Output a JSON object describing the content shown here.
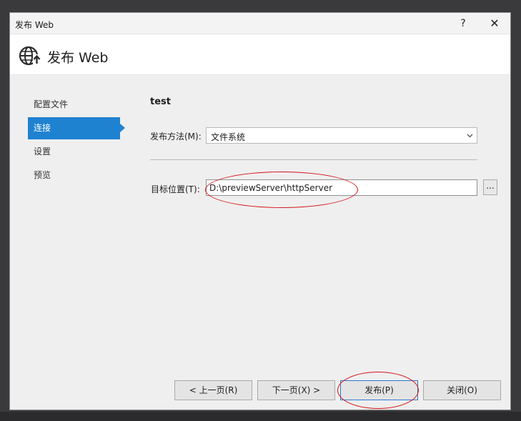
{
  "window": {
    "title": "发布 Web",
    "help_label": "?",
    "close_label": "✕"
  },
  "banner": {
    "title": "发布 Web",
    "icon": "globe-publish-icon"
  },
  "nav": {
    "items": [
      {
        "label": "配置文件",
        "active": false
      },
      {
        "label": "连接",
        "active": true
      },
      {
        "label": "设置",
        "active": false
      },
      {
        "label": "预览",
        "active": false
      }
    ]
  },
  "main": {
    "profile_name": "test",
    "publish_method": {
      "label": "发布方法(M):",
      "mnemonic": "M",
      "value": "文件系统"
    },
    "target_location": {
      "label": "目标位置(T):",
      "mnemonic": "T",
      "value": "D:\\previewServer\\httpServer",
      "browse_label": "..."
    }
  },
  "footer": {
    "prev_label": "< 上一页(R)",
    "next_label": "下一页(X) >",
    "publish_label": "发布(P)",
    "close_label": "关闭(O)"
  },
  "colors": {
    "accent": "#1f82d1",
    "annotation": "#d41616"
  }
}
